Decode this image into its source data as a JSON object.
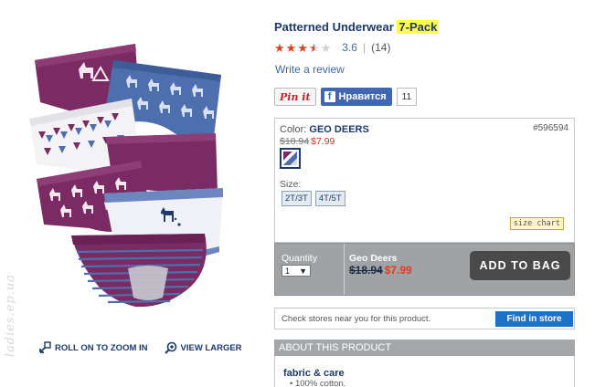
{
  "product": {
    "title": "Patterned Underwear",
    "title_highlight": "7-Pack",
    "rating_value": "3.6",
    "rating_stars": 3.5,
    "rating_separator": "|",
    "review_count": "(14)",
    "write_review": "Write a review"
  },
  "social": {
    "pinit_label": "Pin it",
    "fb_like_label": "Нравится",
    "fb_icon": "f",
    "fb_count": "11"
  },
  "options": {
    "color_label": "Color:",
    "color_name": "GEO DEERS",
    "sku": "#596594",
    "old_price": "$18.94",
    "new_price": "$7.99",
    "size_label": "Size:",
    "sizes": [
      "2T/3T",
      "4T/5T"
    ],
    "size_chart": "size chart"
  },
  "bag": {
    "quantity_label": "Quantity",
    "quantity_value": "1",
    "item_name": "Geo Deers",
    "old_price": "$18.94",
    "new_price": "$7.99",
    "add_to_bag": "ADD TO BAG"
  },
  "store": {
    "check_text": "Check stores near you for this product.",
    "find_button": "Find in store"
  },
  "about": {
    "header": "ABOUT THIS PRODUCT",
    "fabric_title": "fabric & care",
    "fabric_items": [
      "100% cotton."
    ]
  },
  "image_actions": {
    "zoom": "ROLL ON TO ZOOM IN",
    "larger": "VIEW LARGER"
  },
  "watermark": "ladies.ep.ua",
  "colors": {
    "brand_navy": "#1d3a6b",
    "link_blue": "#3b6aa8",
    "sale_red": "#d9331a",
    "highlight_yellow": "#ffff4a",
    "panel_gray": "#9fa3a6",
    "store_blue": "#1d72c8",
    "underwear_plum": "#7b2b63",
    "underwear_blue": "#4e6fae"
  }
}
